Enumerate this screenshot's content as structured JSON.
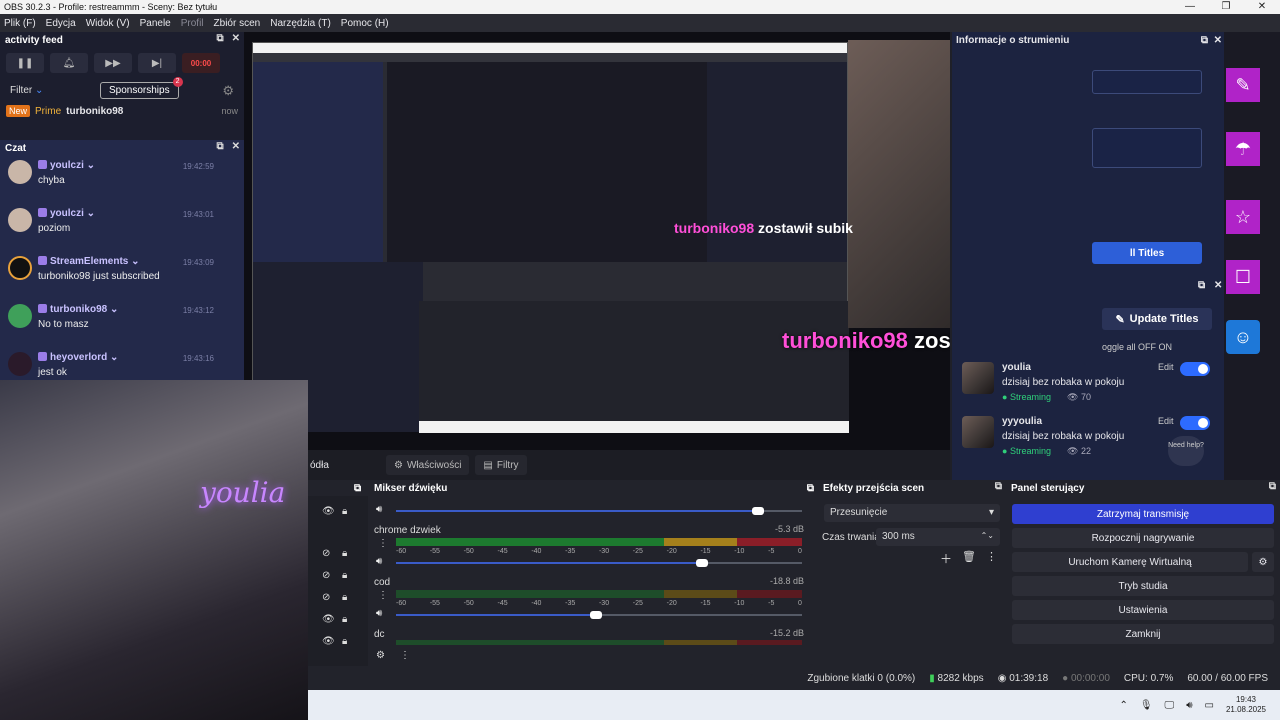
{
  "window": {
    "title": "OBS 30.2.3 - Profile: restreammm - Sceny: Bez tytułu"
  },
  "menu": {
    "items": [
      "Plik (F)",
      "Edycja",
      "Widok (V)",
      "Panele",
      "Profil",
      "Zbiór scen",
      "Narzędzia (T)",
      "Pomoc (H)"
    ]
  },
  "activity": {
    "title": "activity feed",
    "rec_label": "00:00",
    "filter_label": "Filter",
    "sponsor_label": "Sponsorships",
    "sponsor_count": "2",
    "event": {
      "tag_new": "New",
      "tag_prime": "Prime",
      "user": "turboniko98",
      "time": "now"
    }
  },
  "chat": {
    "title": "Czat",
    "messages": [
      {
        "name": "youlczi",
        "text": "chyba",
        "time": "19:42:59"
      },
      {
        "name": "youlczi",
        "text": "poziom",
        "time": "19:43:01"
      },
      {
        "name": "StreamElements",
        "text": "turboniko98 just subscribed",
        "time": "19:43:09"
      },
      {
        "name": "turboniko98",
        "text": "No to masz",
        "time": "19:43:12"
      },
      {
        "name": "heyoverlord",
        "text": "jest ok",
        "time": "19:43:16"
      }
    ]
  },
  "overlay": {
    "user": "turboniko98",
    "text": "zostawił subika! ♡",
    "text_small": "zostawił subik"
  },
  "webcam": {
    "neon": "youlia"
  },
  "streaminfo": {
    "title": "Informacje o strumieniu",
    "titles_btn": "ll Titles",
    "update_btn": "Update Titles",
    "toggle_all": "oggle all OFF  ON",
    "accounts": [
      {
        "name": "youlia",
        "title": "dzisiaj bez robaka w pokoju",
        "status": "Streaming",
        "viewers": "70",
        "edit": "Edit"
      },
      {
        "name": "yyyoulia",
        "title": "dzisiaj bez robaka w pokoju",
        "status": "Streaming",
        "viewers": "22",
        "edit": "Edit"
      }
    ],
    "need_help": "Need help?"
  },
  "sources": {
    "label": "ódła",
    "props": "Właściwości",
    "filters": "Filtry"
  },
  "mixer": {
    "title": "Mikser dźwięku",
    "scale": [
      "-60",
      "-55",
      "-50",
      "-45",
      "-40",
      "-35",
      "-30",
      "-25",
      "-20",
      "-15",
      "-10",
      "-5",
      "0"
    ],
    "channels": [
      {
        "name": "",
        "db": ""
      },
      {
        "name": "chrome dzwiek",
        "db": "-5.3 dB"
      },
      {
        "name": "cod",
        "db": "-18.8 dB"
      },
      {
        "name": "dc",
        "db": "-15.2 dB"
      }
    ]
  },
  "transitions": {
    "title": "Efekty przejścia scen",
    "selected": "Przesunięcie",
    "duration_label": "Czas trwania",
    "duration": "300 ms"
  },
  "controls": {
    "title": "Panel sterujący",
    "buttons": [
      "Zatrzymaj transmisję",
      "Rozpocznij nagrywanie",
      "Uruchom Kamerę Wirtualną",
      "Tryb studia",
      "Ustawienia",
      "Zamknij"
    ]
  },
  "status": {
    "dropped": "Zgubione klatki 0 (0.0%)",
    "bitrate": "8282 kbps",
    "stream_time": "01:39:18",
    "rec_time": "00:00:00",
    "cpu": "CPU: 0.7%",
    "fps": "60.00 / 60.00 FPS"
  },
  "taskbar": {
    "time": "19:43",
    "date": "21.08.2025"
  }
}
